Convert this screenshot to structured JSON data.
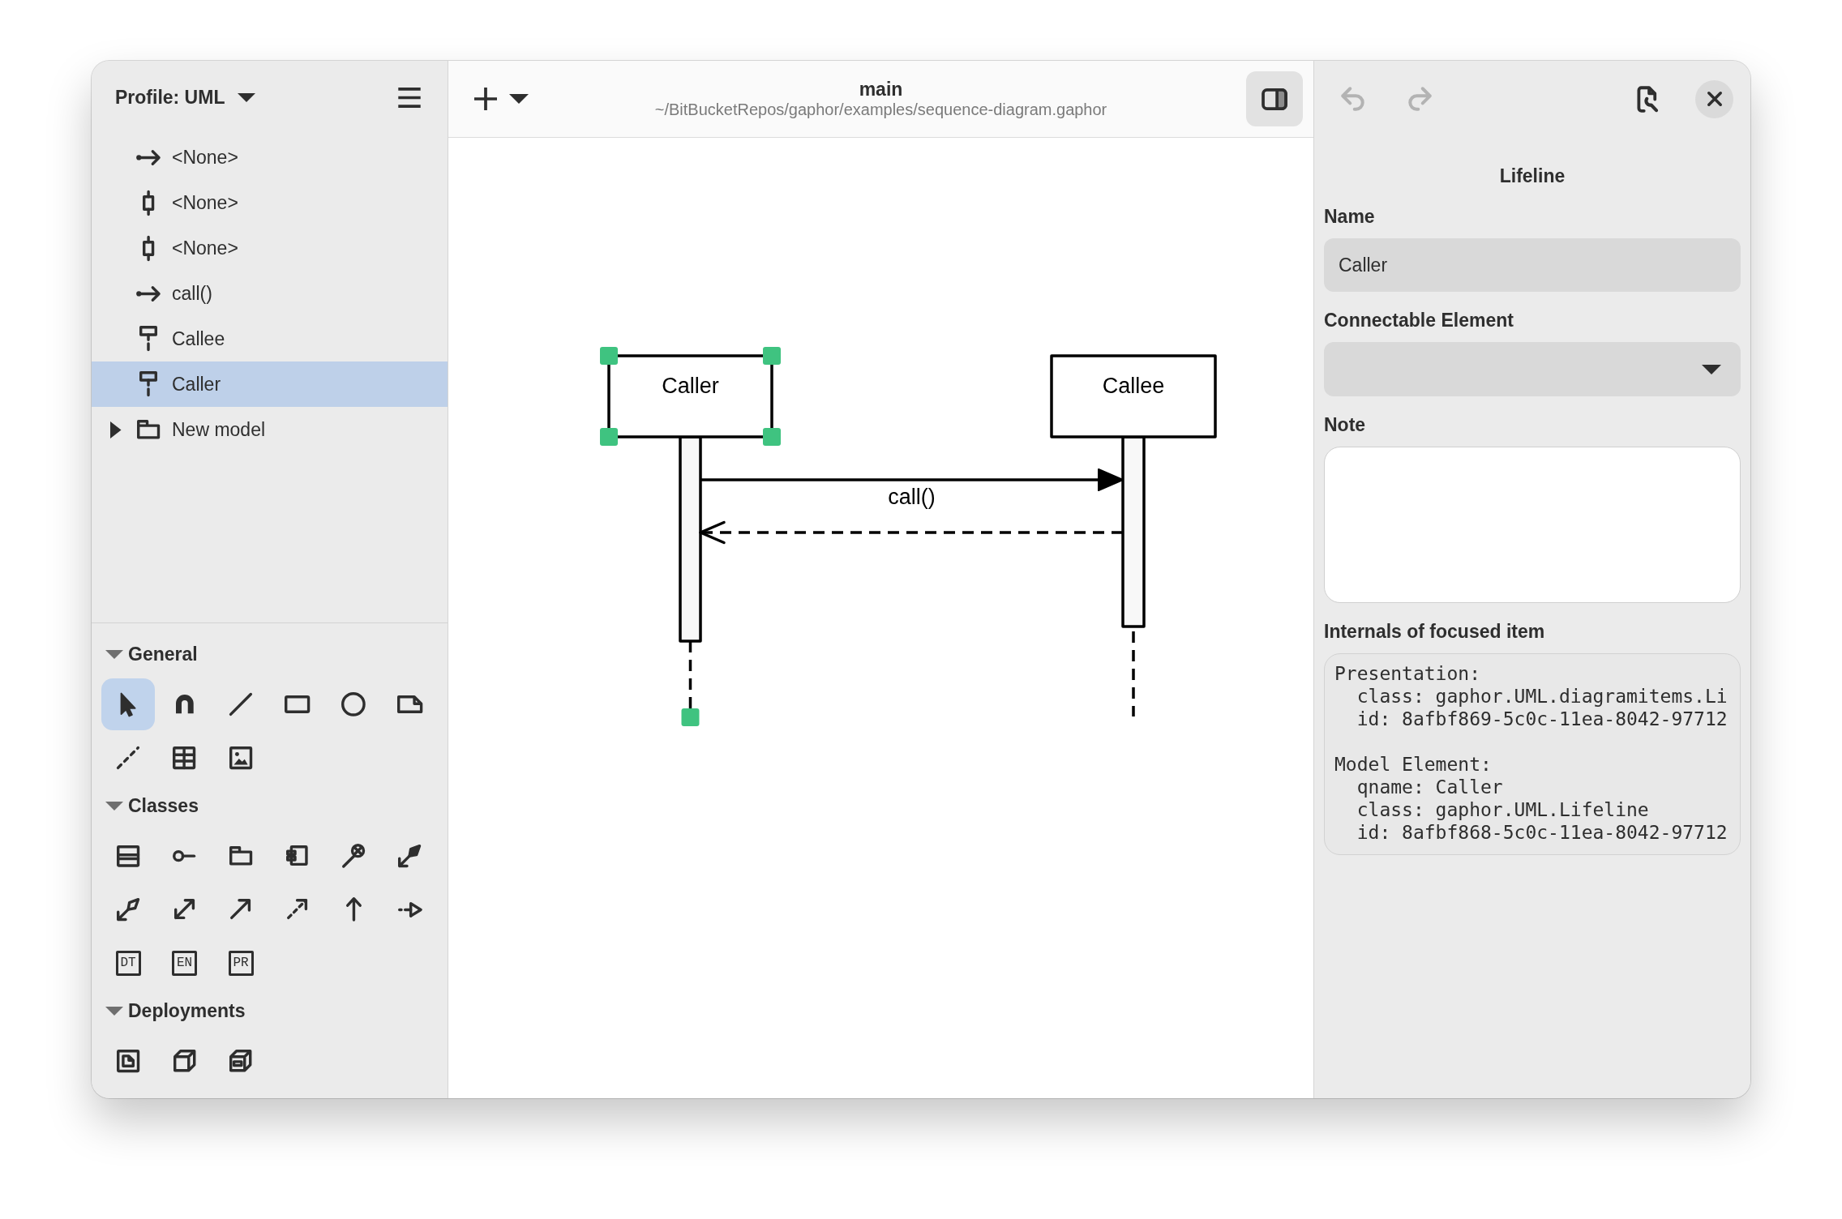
{
  "sidebar": {
    "profile_button": {
      "label": "Profile: UML"
    },
    "model_tree": [
      {
        "kind": "message",
        "label": "<None>",
        "selected": false
      },
      {
        "kind": "execution",
        "label": "<None>",
        "selected": false
      },
      {
        "kind": "execution",
        "label": "<None>",
        "selected": false
      },
      {
        "kind": "message",
        "label": "call()",
        "selected": false
      },
      {
        "kind": "lifeline",
        "label": "Callee",
        "selected": false
      },
      {
        "kind": "lifeline",
        "label": "Caller",
        "selected": true
      },
      {
        "kind": "package",
        "label": "New model",
        "selected": false,
        "expanded": false
      }
    ]
  },
  "toolbox": [
    {
      "title": "General",
      "expanded": true,
      "tools": [
        {
          "kind": "pointer",
          "selected": true
        },
        {
          "kind": "magnet",
          "selected": false
        },
        {
          "kind": "line",
          "selected": false
        },
        {
          "kind": "box",
          "selected": false
        },
        {
          "kind": "ellipse",
          "selected": false
        },
        {
          "kind": "comment",
          "selected": false
        },
        {
          "kind": "comment_line",
          "selected": false
        },
        {
          "kind": "metadata",
          "selected": false
        },
        {
          "kind": "image",
          "selected": false
        }
      ]
    },
    {
      "title": "Classes",
      "expanded": true,
      "tools": [
        {
          "kind": "class",
          "selected": false
        },
        {
          "kind": "interface",
          "selected": false
        },
        {
          "kind": "package",
          "selected": false
        },
        {
          "kind": "component",
          "selected": false
        },
        {
          "kind": "containment",
          "selected": false
        },
        {
          "kind": "composition",
          "selected": false
        },
        {
          "kind": "shared_aggregation",
          "selected": false
        },
        {
          "kind": "association",
          "selected": false
        },
        {
          "kind": "directed_association",
          "selected": false
        },
        {
          "kind": "dependency",
          "selected": false
        },
        {
          "kind": "generalization",
          "selected": false
        },
        {
          "kind": "interface_realization",
          "selected": false
        },
        {
          "kind": "lettered",
          "label": "DT",
          "selected": false
        },
        {
          "kind": "lettered",
          "label": "EN",
          "selected": false
        },
        {
          "kind": "lettered",
          "label": "PR",
          "selected": false
        }
      ]
    },
    {
      "title": "Deployments",
      "expanded": true,
      "tools": [
        {
          "kind": "artifact",
          "selected": false
        },
        {
          "kind": "node",
          "selected": false
        },
        {
          "kind": "device",
          "selected": false
        }
      ]
    }
  ],
  "editor": {
    "title": "main",
    "path": "~/BitBucketRepos/gaphor/examples/sequence-diagram.gaphor",
    "panel_toggle": {
      "on": true
    },
    "diagram": {
      "lifelines": [
        {
          "name": "Caller",
          "selected": true
        },
        {
          "name": "Callee",
          "selected": false
        }
      ],
      "messages": [
        {
          "kind": "call",
          "label": "call()"
        },
        {
          "kind": "reply"
        }
      ]
    }
  },
  "inspector": {
    "undo": {
      "disabled": true
    },
    "redo": {
      "disabled": true
    },
    "title": "Lifeline",
    "name_field": {
      "label": "Name",
      "value": "Caller"
    },
    "connectable_element": {
      "label": "Connectable Element"
    },
    "note": {
      "label": "Note"
    },
    "internals": {
      "label": "Internals of focused item",
      "sections": [
        {
          "heading": "Presentation:",
          "lines": [
            "class: gaphor.UML.diagramitems.Li",
            "id: 8afbf869-5c0c-11ea-8042-97712"
          ]
        },
        {
          "heading": "Model Element:",
          "lines": [
            "qname: Caller",
            "class: gaphor.UML.Lifeline",
            "id: 8afbf868-5c0c-11ea-8042-97712"
          ]
        }
      ]
    }
  }
}
